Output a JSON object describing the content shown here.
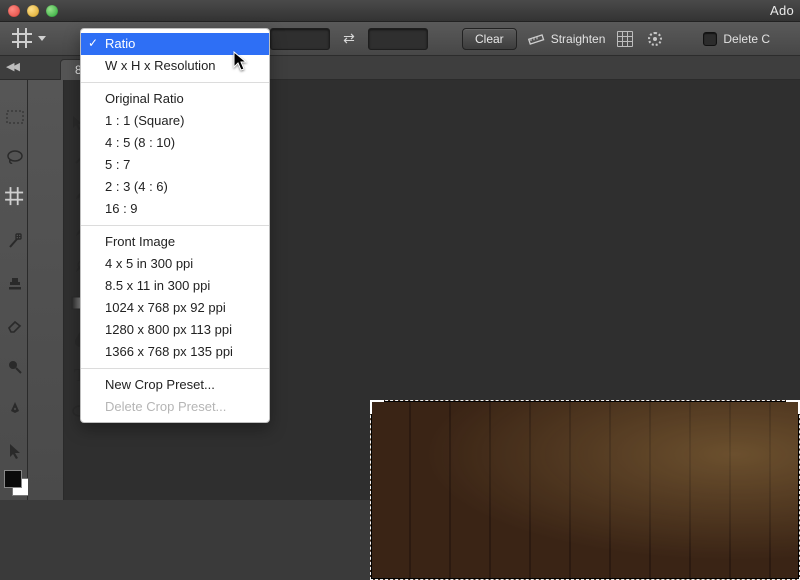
{
  "titlebar": {
    "app_title": "Ado"
  },
  "options": {
    "clear_label": "Clear",
    "straighten_label": "Straighten",
    "delete_label": "Delete C"
  },
  "tabstrip": {
    "doc_suffix": "8/8)"
  },
  "menu": {
    "ratio": "Ratio",
    "wxh": "W x H x Resolution",
    "original": "Original Ratio",
    "r11": "1 : 1 (Square)",
    "r45": "4 : 5 (8 : 10)",
    "r57": "5 : 7",
    "r23": "2 : 3 (4 : 6)",
    "r169": "16 : 9",
    "front": "Front Image",
    "p1": "4 x 5 in 300 ppi",
    "p2": "8.5 x 11 in 300 ppi",
    "p3": "1024 x 768 px 92 ppi",
    "p4": "1280 x 800 px 113 ppi",
    "p5": "1366 x 768 px 135 ppi",
    "new_preset": "New Crop Preset...",
    "delete_preset": "Delete Crop Preset..."
  }
}
